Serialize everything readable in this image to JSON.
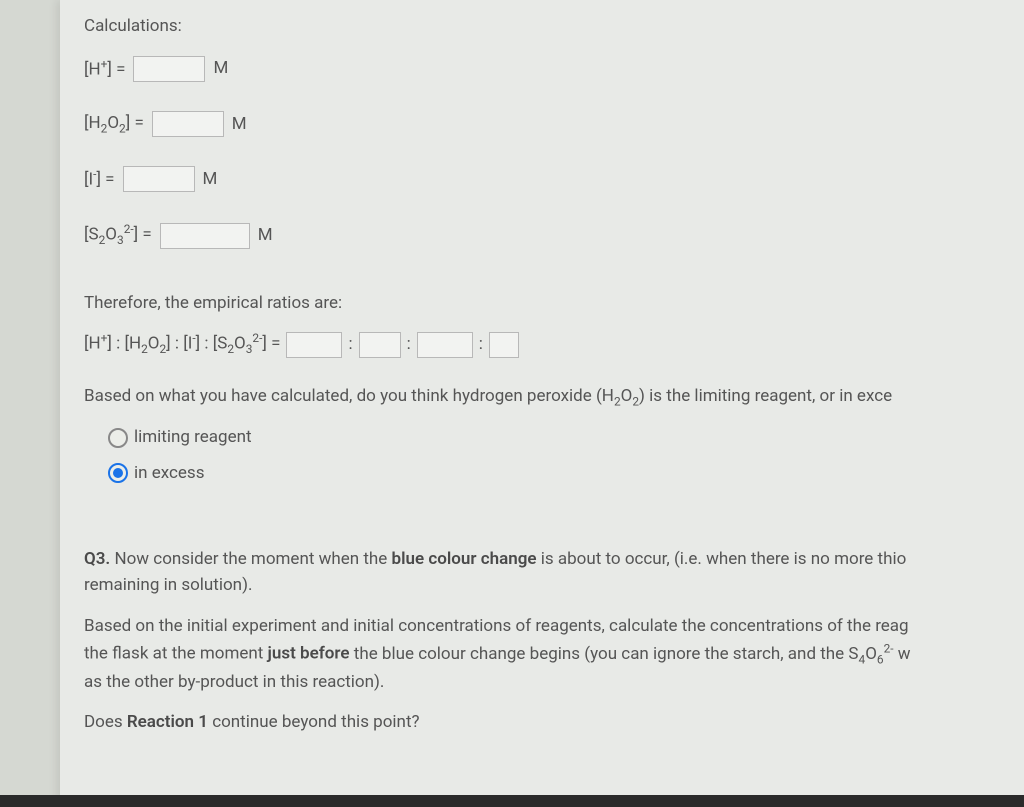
{
  "heading": "Calculations:",
  "species": {
    "h_plus": "[H⁺] =",
    "h2o2": "[H₂O₂] =",
    "iodide": "[I⁻] =",
    "thiosulfate": "[S₂O₃²⁻] ="
  },
  "unit": "M",
  "therefore": "Therefore, the empirical ratios are:",
  "ratio_label": "[H⁺] : [H₂O₂] : [I⁻] : [S₂O₃²⁻] =",
  "colon": ":",
  "question_limiting": "Based on what you have calculated, do you think hydrogen peroxide (H₂O₂) is the limiting reagent, or in exce",
  "radio": {
    "limiting": "limiting reagent",
    "excess": "in excess",
    "selected": "excess"
  },
  "q3": {
    "num": "Q3.",
    "p1a": " Now consider the moment when the ",
    "p1b": "blue colour change",
    "p1c": " is about to occur, (i.e. when there is no more thio",
    "p1d": "remaining in solution).",
    "p2a": "Based on the initial experiment and initial concentrations of reagents, calculate the concentrations of the reag",
    "p2b": "the flask at the moment ",
    "p2c": "just before",
    "p2d": " the blue colour change begins (you can ignore the starch, and the S₄O₆²⁻ w",
    "p2e": "as the other by-product in this reaction).",
    "p3a": "Does ",
    "p3b": "Reaction 1",
    "p3c": " continue beyond this point?"
  }
}
